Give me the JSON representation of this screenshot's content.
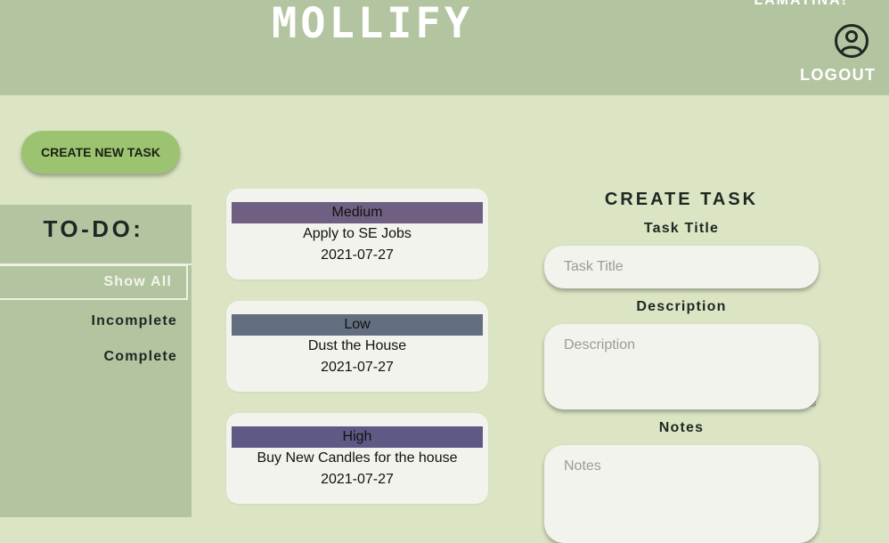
{
  "header": {
    "brand": "MOLLIFY",
    "greeting": "LAMATINA!",
    "logout_label": "LOGOUT",
    "user_icon": "user-circle-icon"
  },
  "actions": {
    "create_new_task_label": "CREATE NEW TASK"
  },
  "sidebar": {
    "title": "TO-DO:",
    "filters": [
      {
        "label": "Show All",
        "active": true
      },
      {
        "label": "Incomplete",
        "active": false
      },
      {
        "label": "Complete",
        "active": false
      }
    ]
  },
  "tasks": [
    {
      "priority": "Medium",
      "title": "Apply to SE Jobs",
      "date": "2021-07-27",
      "priority_color": "#6f5f82"
    },
    {
      "priority": "Low",
      "title": "Dust the House",
      "date": "2021-07-27",
      "priority_color": "#636f80"
    },
    {
      "priority": "High",
      "title": "Buy New Candles for the house",
      "date": "2021-07-27",
      "priority_color": "#5e5a85"
    }
  ],
  "form": {
    "title": "CREATE TASK",
    "task_title_label": "Task Title",
    "task_title_placeholder": "Task Title",
    "description_label": "Description",
    "description_placeholder": "Description",
    "notes_label": "Notes",
    "notes_placeholder": "Notes"
  },
  "colors": {
    "background": "#dbe5c4",
    "header": "#b3c4a0",
    "accent_button": "#9cc36f",
    "card": "#f3f3ee"
  }
}
